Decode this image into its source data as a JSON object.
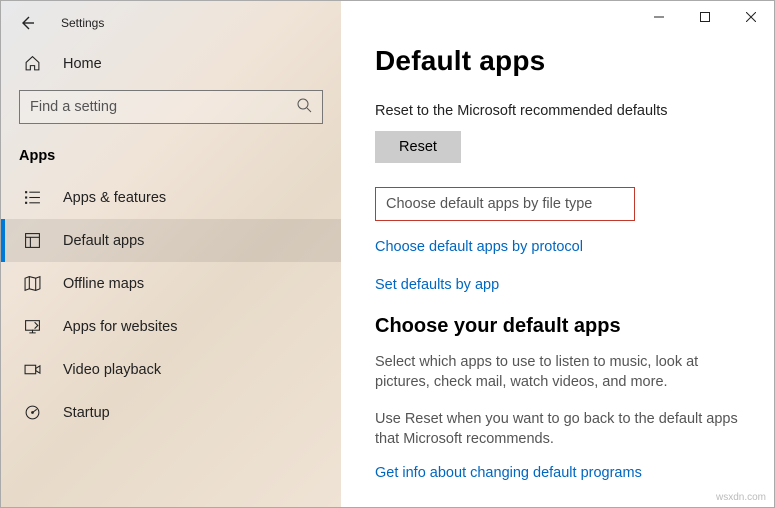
{
  "window": {
    "app_title": "Settings"
  },
  "sidebar": {
    "home_label": "Home",
    "search_placeholder": "Find a setting",
    "section": "Apps",
    "items": [
      {
        "label": "Apps & features"
      },
      {
        "label": "Default apps"
      },
      {
        "label": "Offline maps"
      },
      {
        "label": "Apps for websites"
      },
      {
        "label": "Video playback"
      },
      {
        "label": "Startup"
      }
    ]
  },
  "main": {
    "title": "Default apps",
    "reset_heading": "Reset to the Microsoft recommended defaults",
    "reset_button": "Reset",
    "link_filetype": "Choose default apps by file type",
    "link_protocol": "Choose default apps by protocol",
    "link_byapp": "Set defaults by app",
    "choose_heading": "Choose your default apps",
    "choose_para1": "Select which apps to use to listen to music, look at pictures, check mail, watch videos, and more.",
    "choose_para2": "Use Reset when you want to go back to the default apps that Microsoft recommends.",
    "link_info": "Get info about changing default programs"
  },
  "watermark": "wsxdn.com"
}
